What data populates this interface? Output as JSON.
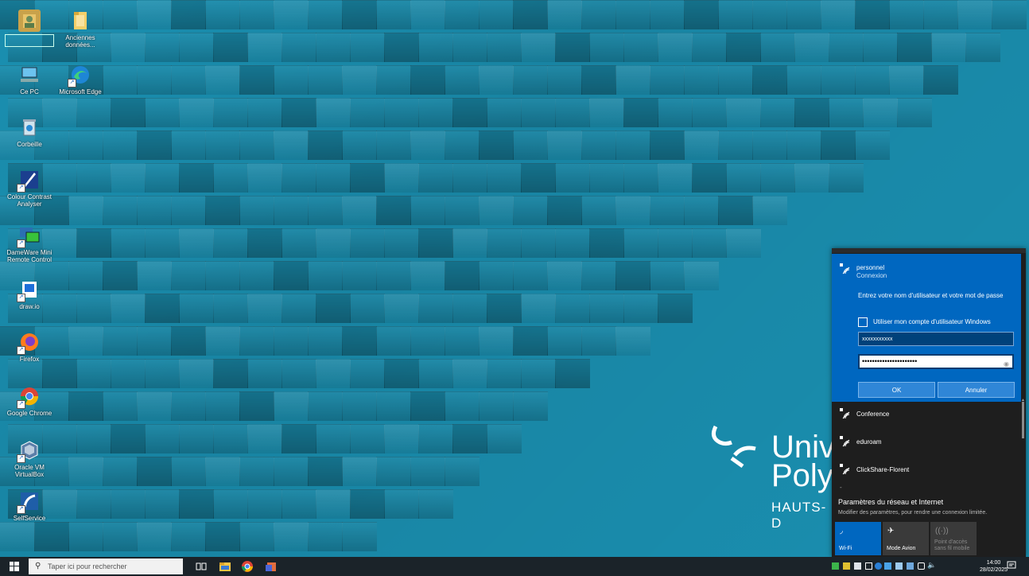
{
  "desktop": {
    "icons": [
      {
        "label": ""
      },
      {
        "label": "Anciennes données..."
      },
      {
        "label": "Ce PC"
      },
      {
        "label": "Microsoft Edge"
      },
      {
        "label": "Corbeille"
      },
      {
        "label": "Colour Contrast Analyser"
      },
      {
        "label": "DameWare Mini Remote Control"
      },
      {
        "label": "draw.io"
      },
      {
        "label": "Firefox"
      },
      {
        "label": "Google Chrome"
      },
      {
        "label": "Oracle VM VirtualBox"
      },
      {
        "label": "SelfService"
      }
    ],
    "logo": {
      "line1": "Univ",
      "line2": "Poly",
      "line3": "HAUTS-D"
    }
  },
  "flyout": {
    "connecting": {
      "ssid": "personnel",
      "status": "Connexion",
      "prompt": "Entrez votre nom d'utilisateur et votre mot de passe",
      "checkbox_label": "Utiliser mon compte d'utilisateur Windows",
      "username_value": "xxxxxxxxxxx",
      "password_value": "••••••••••••••••••••••",
      "ok_label": "OK",
      "cancel_label": "Annuler"
    },
    "networks": [
      {
        "name": "Conference"
      },
      {
        "name": "eduroam"
      },
      {
        "name": "ClickShare-Florent"
      }
    ],
    "settings_title": "Paramètres du réseau et Internet",
    "settings_subtitle": "Modifier des paramètres, pour rendre une connexion limitée.",
    "quick_actions": [
      {
        "label": "Wi-Fi",
        "active": true
      },
      {
        "label": "Mode Avion",
        "active": false
      },
      {
        "label": "Point d'accès sans fil mobile",
        "active": false
      }
    ]
  },
  "taskbar": {
    "search_placeholder": "Taper ici pour rechercher",
    "time": "14:00",
    "date": "28/02/2025"
  },
  "colors": {
    "accent": "#0067c0",
    "wallpaper": "#1a8fb0",
    "taskbar": "#1b2329"
  }
}
